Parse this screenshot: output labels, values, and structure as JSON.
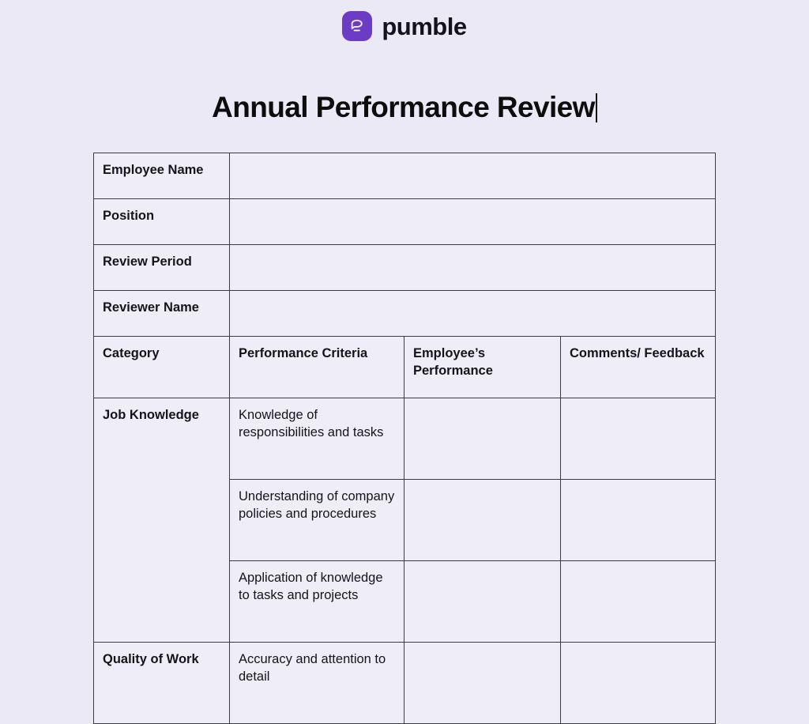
{
  "brand": {
    "name": "pumble",
    "logo_icon": "speech-bubble-icon",
    "logo_color": "#6d3cc4"
  },
  "document": {
    "title": "Annual Performance Review",
    "caret_visible": true
  },
  "theme": {
    "page_background": "#ece9f6",
    "header_fill": "#b59cea",
    "cell_fill": "#efedf7",
    "border_color": "#3b3b46",
    "text_color": "#14141a"
  },
  "info_fields": [
    {
      "label": "Employee Name",
      "value": ""
    },
    {
      "label": "Position",
      "value": ""
    },
    {
      "label": "Review Period",
      "value": ""
    },
    {
      "label": "Reviewer Name",
      "value": ""
    }
  ],
  "table_headers": {
    "category": "Category",
    "criteria": "Performance Criteria",
    "performance": "Employee’s Performance",
    "comments": "Comments/ Feedback"
  },
  "sections": [
    {
      "category": "Job Knowledge",
      "rows": [
        {
          "criteria": "Knowledge of responsibilities and tasks",
          "performance": "",
          "comments": ""
        },
        {
          "criteria": "Understanding of company policies and procedures",
          "performance": "",
          "comments": ""
        },
        {
          "criteria": "Application of knowledge to tasks and projects",
          "performance": "",
          "comments": ""
        }
      ]
    },
    {
      "category": "Quality of Work",
      "rows": [
        {
          "criteria": "Accuracy and attention to detail",
          "performance": "",
          "comments": ""
        }
      ]
    }
  ]
}
